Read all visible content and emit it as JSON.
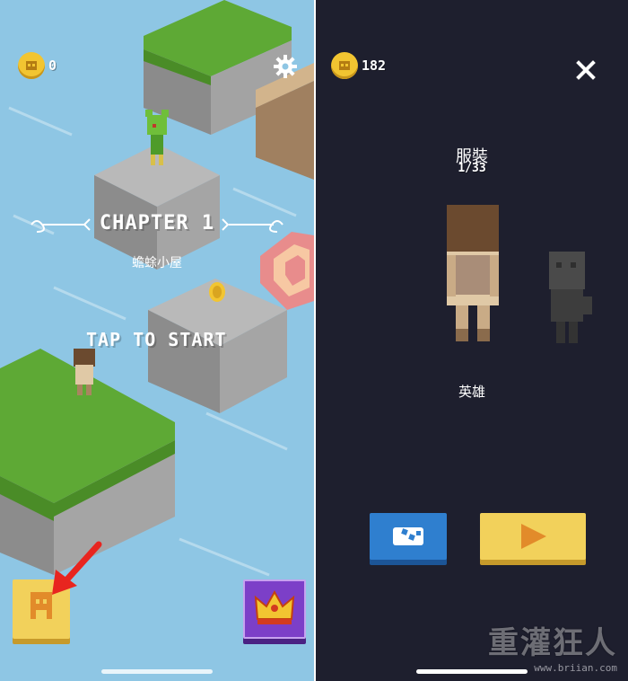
{
  "left": {
    "coins": "0",
    "chapter_label": "CHAPTER 1",
    "level_name": "蟾蜍小屋",
    "start_prompt": "TAP TO START",
    "icons": [
      "coin-icon",
      "gear-icon",
      "character-icon",
      "crown-icon",
      "red-arrow-annotation"
    ]
  },
  "right": {
    "coins": "182",
    "section_title": "服裝",
    "counter": "1/33",
    "character_name": "英雄",
    "icons": [
      "coin-icon",
      "close-icon",
      "dice-icon",
      "play-icon"
    ]
  },
  "watermark": {
    "brand": "重灌狂人",
    "url": "www.briian.com"
  },
  "colors": {
    "water": "#8ec6e4",
    "grass": "#5ea935",
    "stone": "#9b9b9b",
    "panel_dark": "#1e1f2e",
    "button_yellow": "#f2d15b",
    "button_blue": "#2f7fcf",
    "button_purple": "#7c3fc8",
    "accent_orange": "#e28b2a",
    "annotation_red": "#e8251f"
  }
}
